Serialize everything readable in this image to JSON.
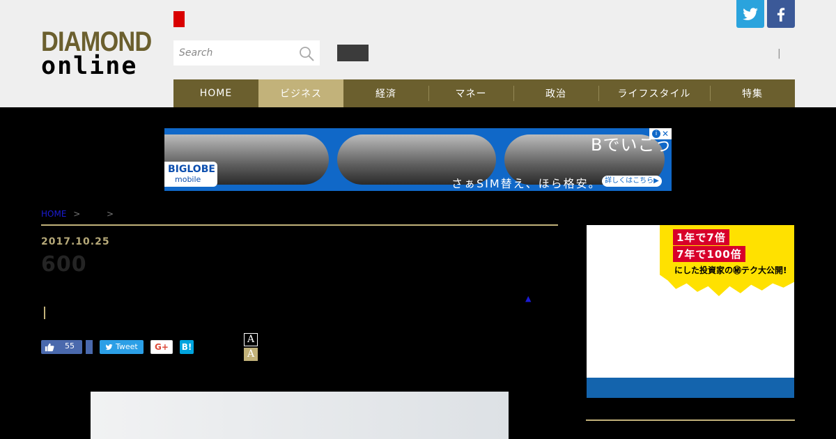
{
  "header": {
    "logo_top": "DIAMOND",
    "logo_bottom": "online",
    "search_placeholder": "Search",
    "separator": "|"
  },
  "nav": {
    "items": [
      {
        "label": "HOME"
      },
      {
        "label": "ビジネス"
      },
      {
        "label": "経済"
      },
      {
        "label": "マネー"
      },
      {
        "label": "政治"
      },
      {
        "label": "ライフスタイル"
      },
      {
        "label": "特集"
      }
    ],
    "active_index": 1
  },
  "ad_banner": {
    "logo": "BIGLOBE",
    "logo_sub": "mobile",
    "headline": "Bでいこう。",
    "tagline": "さぁSIM替え、ほら格安。",
    "cta": "詳しくはこちら▶",
    "info_icon": "i",
    "close_icon": "✕"
  },
  "breadcrumb": {
    "home": "HOME",
    "sep": ">"
  },
  "article": {
    "date": "2017.10.25",
    "title": "600",
    "up_arrow": "▲"
  },
  "share": {
    "like_count": "55",
    "tweet": "Tweet",
    "gplus": "G+",
    "hatena": "B!",
    "font_small": "A",
    "font_large": "A"
  },
  "side_ad": {
    "line1": "1年で7倍",
    "line2": "7年で100倍",
    "line3": "にした投資家の㊙テク大公開!"
  },
  "colors": {
    "brand_olive": "#6b5f2e",
    "accent_gold": "#c2b27a",
    "twitter": "#2aa3dd",
    "facebook": "#3b5998",
    "ad_blue": "#1068c8"
  },
  "icons": {
    "search": "search-icon",
    "twitter": "twitter-icon",
    "facebook": "facebook-icon",
    "like": "thumbs-up-icon",
    "tweet": "twitter-bird-icon"
  }
}
